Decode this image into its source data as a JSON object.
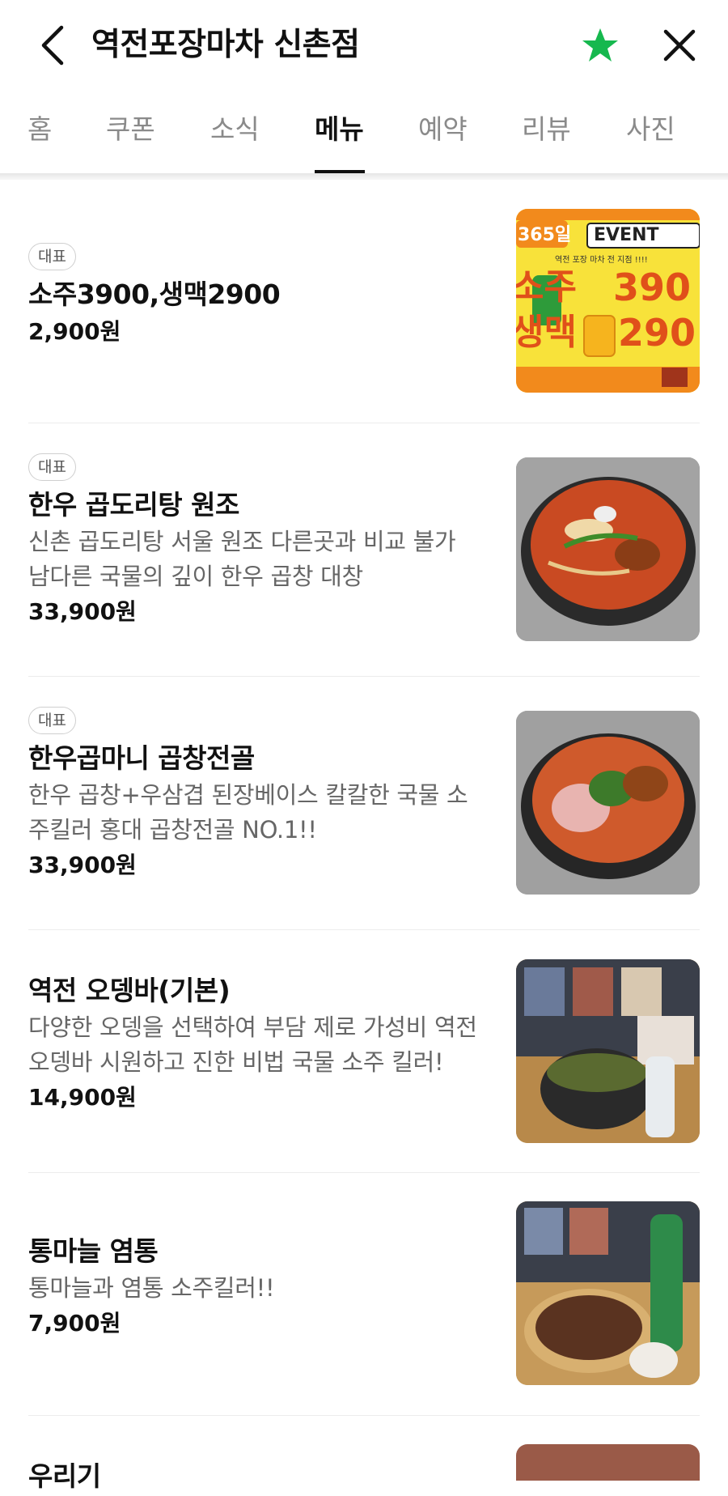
{
  "header": {
    "title": "역전포장마차 신촌점",
    "back_icon": "back-arrow-icon",
    "favorite_icon": "star-icon",
    "favorite_color": "#16b84e",
    "close_icon": "close-icon"
  },
  "tabs": [
    {
      "label": "홈"
    },
    {
      "label": "쿠폰"
    },
    {
      "label": "소식"
    },
    {
      "label": "메뉴",
      "active": true
    },
    {
      "label": "예약"
    },
    {
      "label": "리뷰"
    },
    {
      "label": "사진"
    }
  ],
  "menu": [
    {
      "badge": "대표",
      "name": "소주3900,생맥2900",
      "desc": "",
      "price": "2,900원",
      "image": {
        "banner_top": "365일",
        "banner_event": "EVENT",
        "banner_sub": "역전 포장 마차 전 지점 !!!!",
        "banner_soju": "소주",
        "banner_soju_price": "390",
        "banner_beer": "생맥",
        "banner_beer_price": "290"
      }
    },
    {
      "badge": "대표",
      "name": "한우 곱도리탕 원조",
      "desc": "신촌 곱도리탕 서울 원조 다른곳과 비교 불가 남다른 국물의 깊이 한우 곱창 대창",
      "price": "33,900원"
    },
    {
      "badge": "대표",
      "name": "한우곱마니 곱창전골",
      "desc": "한우 곱창+우삼겹 된장베이스 칼칼한 국물 소주킬러 홍대 곱창전골 NO.1!!",
      "price": "33,900원"
    },
    {
      "badge": "",
      "name": "역전 오뎅바(기본)",
      "desc": "다양한 오뎅을 선택하여 부담 제로 가성비 역전 오뎅바 시원하고 진한 비법 국물 소주 킬러!",
      "price": "14,900원"
    },
    {
      "badge": "",
      "name": "통마늘 염통",
      "desc": "통마늘과 염통 소주킬러!!",
      "price": "7,900원"
    },
    {
      "badge": "",
      "name": "우리기",
      "desc": "",
      "price": ""
    }
  ]
}
